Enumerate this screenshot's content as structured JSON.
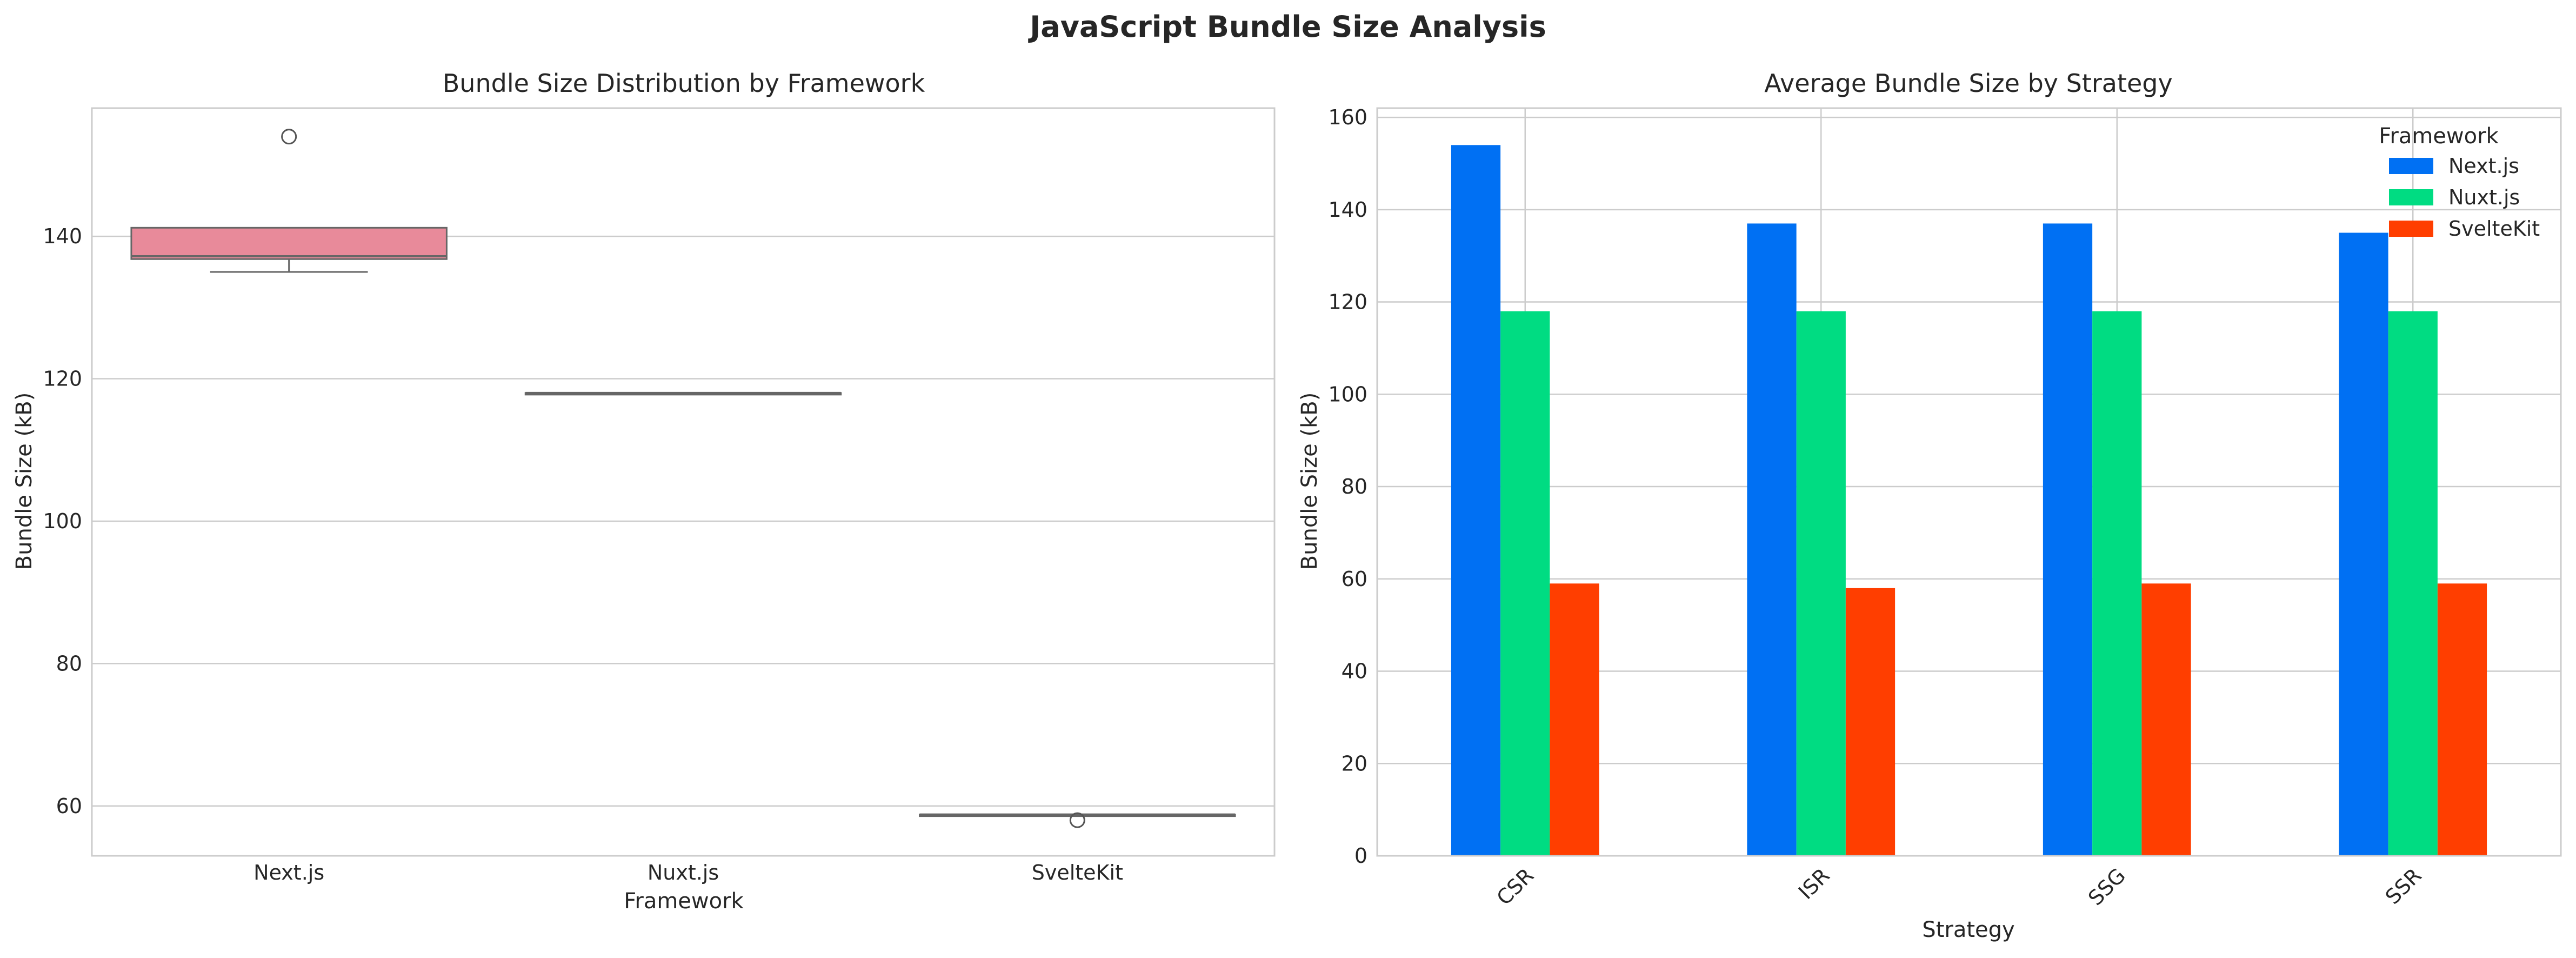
{
  "figure": {
    "title": "JavaScript Bundle Size Analysis"
  },
  "chart_data": [
    {
      "type": "box",
      "title": "Bundle Size Distribution by Framework",
      "xlabel": "Framework",
      "ylabel": "Bundle Size (kB)",
      "categories": [
        "Next.js",
        "Nuxt.js",
        "SvelteKit"
      ],
      "ylim": [
        53,
        158
      ],
      "yticks": [
        60,
        80,
        100,
        120,
        140
      ],
      "grid": true,
      "boxes": [
        {
          "name": "Next.js",
          "whisker_low": 135,
          "q1": 136.8,
          "median": 137.2,
          "q3": 141.2,
          "whisker_high": 141.2,
          "outliers": [
            154
          ],
          "color": "#e88a9a"
        },
        {
          "name": "Nuxt.js",
          "whisker_low": 118,
          "q1": 118,
          "median": 118,
          "q3": 118,
          "whisker_high": 118,
          "outliers": [],
          "color": "#c9a348"
        },
        {
          "name": "SvelteKit",
          "whisker_low": 58.8,
          "q1": 58.8,
          "median": 58.8,
          "q3": 58.8,
          "whisker_high": 58.8,
          "outliers": [
            58
          ],
          "color": "#5ab56e"
        }
      ]
    },
    {
      "type": "bar",
      "title": "Average Bundle Size by Strategy",
      "xlabel": "Strategy",
      "ylabel": "Bundle Size (kB)",
      "categories": [
        "CSR",
        "ISR",
        "SSG",
        "SSR"
      ],
      "ylim": [
        0,
        162
      ],
      "yticks": [
        0,
        20,
        40,
        60,
        80,
        100,
        120,
        140,
        160
      ],
      "grid": true,
      "legend": {
        "title": "Framework",
        "position": "top-right"
      },
      "series": [
        {
          "name": "Next.js",
          "values": [
            154,
            137,
            137,
            135
          ],
          "color": "#0070f3"
        },
        {
          "name": "Nuxt.js",
          "values": [
            118,
            118,
            118,
            118
          ],
          "color": "#00dc82"
        },
        {
          "name": "SvelteKit",
          "values": [
            59,
            58,
            59,
            59
          ],
          "color": "#ff3e00"
        }
      ]
    }
  ]
}
